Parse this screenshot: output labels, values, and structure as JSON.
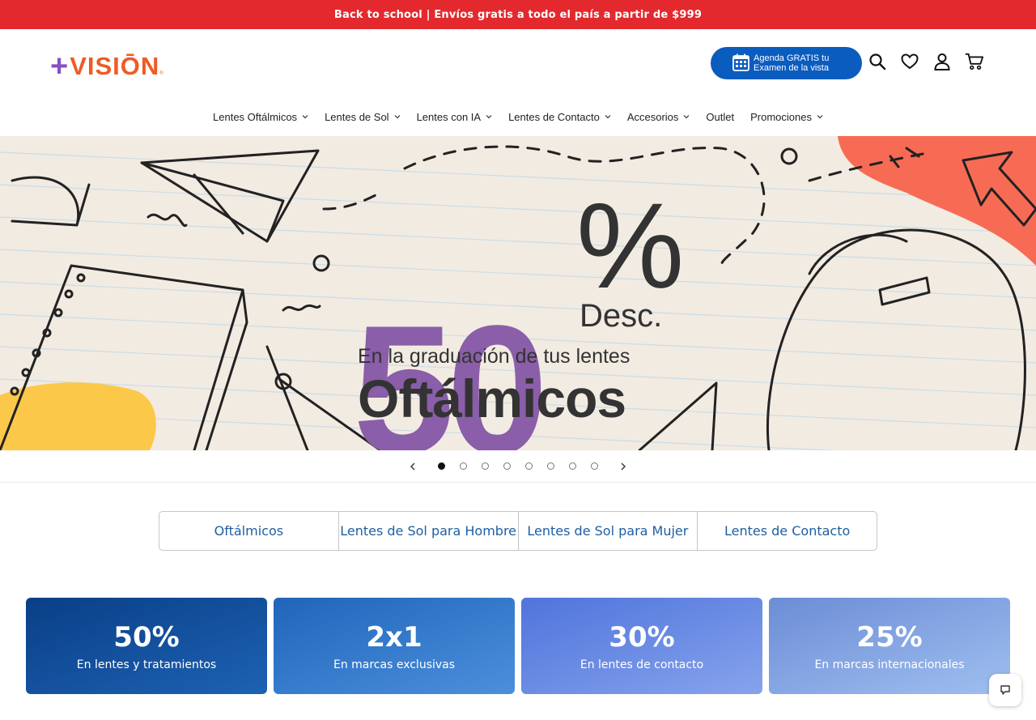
{
  "announcement": "Back to school | Envíos gratis a todo el país a partir de $999",
  "logo": {
    "plus": "+",
    "word": "VISIŌN",
    "reg": "®"
  },
  "cta": {
    "line1": "Agenda GRATIS tu",
    "line2": "Examen de la vista"
  },
  "header_icons": [
    "search-icon",
    "heart-icon",
    "user-icon",
    "cart-icon"
  ],
  "nav": [
    {
      "label": "Lentes Oftálmicos",
      "dropdown": true
    },
    {
      "label": "Lentes de Sol",
      "dropdown": true
    },
    {
      "label": "Lentes con IA",
      "dropdown": true
    },
    {
      "label": "Lentes de Contacto",
      "dropdown": true
    },
    {
      "label": "Accesorios",
      "dropdown": true
    },
    {
      "label": "Outlet",
      "dropdown": false
    },
    {
      "label": "Promociones",
      "dropdown": true
    }
  ],
  "hero": {
    "big": "50",
    "pct": "%",
    "desc": "Desc.",
    "line1": "En la graduación de tus lentes",
    "line2": "Oftálmicos"
  },
  "slider": {
    "count": 8,
    "active": 0
  },
  "tabs": [
    "Oftálmicos",
    "Lentes de Sol para Hombre",
    "Lentes de Sol para Mujer",
    "Lentes de Contacto"
  ],
  "cards": [
    {
      "number": "50%",
      "subtitle": "En lentes y tratamientos"
    },
    {
      "number": "2x1",
      "subtitle": "En marcas exclusivas"
    },
    {
      "number": "30%",
      "subtitle": "En lentes de contacto"
    },
    {
      "number": "25%",
      "subtitle": "En marcas internacionales"
    }
  ],
  "colors": {
    "announce": "#e3292e",
    "cta": "#0b5cbf",
    "hero_purple": "#8a5ea8",
    "logo_orange": "#ef5b24",
    "logo_purple": "#8a4fc0",
    "tab_text": "#1d5fa3"
  }
}
